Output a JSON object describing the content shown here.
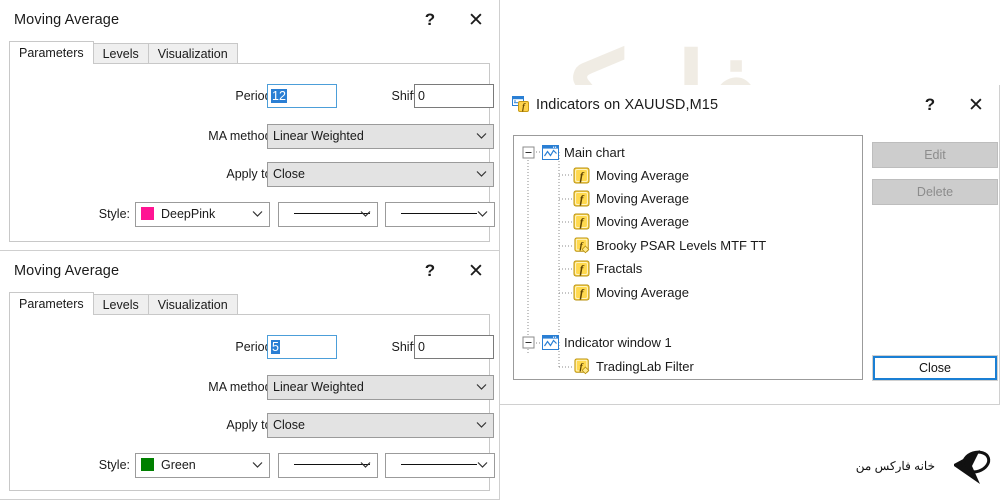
{
  "background_watermark": {
    "texts": [
      "خانه فارکس من",
      "خانه فارکس من",
      "خانه فارکس من",
      "خانه فارکس من",
      "فارکس"
    ]
  },
  "corner_logo": {
    "text": "خانه فارکس من",
    "icon": "forex-house-logo-icon"
  },
  "colors": {
    "accent": "#1a7fd4",
    "selection": "#2a7fd4",
    "deeppink": "#ff1493",
    "green": "#008000",
    "disabled_text": "#8c8c8c"
  },
  "dialogs": [
    {
      "id": "moving-average-1",
      "title": "Moving Average",
      "help_label": "?",
      "close_label": "✕",
      "tabs": [
        {
          "label": "Parameters",
          "active": true
        },
        {
          "label": "Levels",
          "active": false
        },
        {
          "label": "Visualization",
          "active": false
        }
      ],
      "fields": {
        "period_label": "Period:",
        "period_value": "12",
        "period_selected": true,
        "shift_label": "Shift:",
        "shift_value": "0",
        "ma_method_label": "MA method:",
        "ma_method_value": "Linear Weighted",
        "apply_to_label": "Apply to:",
        "apply_to_value": "Close",
        "style_label": "Style:",
        "style_color_name": "DeepPink",
        "style_color_hex": "#ff1493",
        "style_linetype": "solid-line",
        "style_thickness": "solid-line"
      }
    },
    {
      "id": "moving-average-2",
      "title": "Moving Average",
      "help_label": "?",
      "close_label": "✕",
      "tabs": [
        {
          "label": "Parameters",
          "active": true
        },
        {
          "label": "Levels",
          "active": false
        },
        {
          "label": "Visualization",
          "active": false
        }
      ],
      "fields": {
        "period_label": "Period:",
        "period_value": "5",
        "period_selected": true,
        "shift_label": "Shift:",
        "shift_value": "0",
        "ma_method_label": "MA method:",
        "ma_method_value": "Linear Weighted",
        "apply_to_label": "Apply to:",
        "apply_to_value": "Close",
        "style_label": "Style:",
        "style_color_name": "Green",
        "style_color_hex": "#008000",
        "style_linetype": "solid-line",
        "style_thickness": "solid-line"
      }
    }
  ],
  "indicators_dialog": {
    "title": "Indicators on XAUUSD,M15",
    "title_icon": "indicators-window-icon",
    "help_label": "?",
    "close_label": "✕",
    "tree": [
      {
        "label": "Main chart",
        "level": 0,
        "icon": "chart-window-icon",
        "expander": "minus"
      },
      {
        "label": "Moving Average",
        "level": 1,
        "icon": "builtin-indicator-icon"
      },
      {
        "label": "Moving Average",
        "level": 1,
        "icon": "builtin-indicator-icon"
      },
      {
        "label": "Moving Average",
        "level": 1,
        "icon": "builtin-indicator-icon"
      },
      {
        "label": "Brooky PSAR Levels MTF TT",
        "level": 1,
        "icon": "custom-indicator-icon"
      },
      {
        "label": "Fractals",
        "level": 1,
        "icon": "builtin-indicator-icon"
      },
      {
        "label": "Moving Average",
        "level": 1,
        "icon": "builtin-indicator-icon"
      },
      {
        "label": "Indicator window 1",
        "level": 0,
        "icon": "chart-window-icon",
        "expander": "minus"
      },
      {
        "label": "TradingLab Filter",
        "level": 1,
        "icon": "custom-indicator-icon"
      }
    ],
    "buttons": {
      "edit": {
        "label": "Edit",
        "enabled": false
      },
      "delete": {
        "label": "Delete",
        "enabled": false
      },
      "close": {
        "label": "Close",
        "enabled": true,
        "default": true
      }
    }
  }
}
